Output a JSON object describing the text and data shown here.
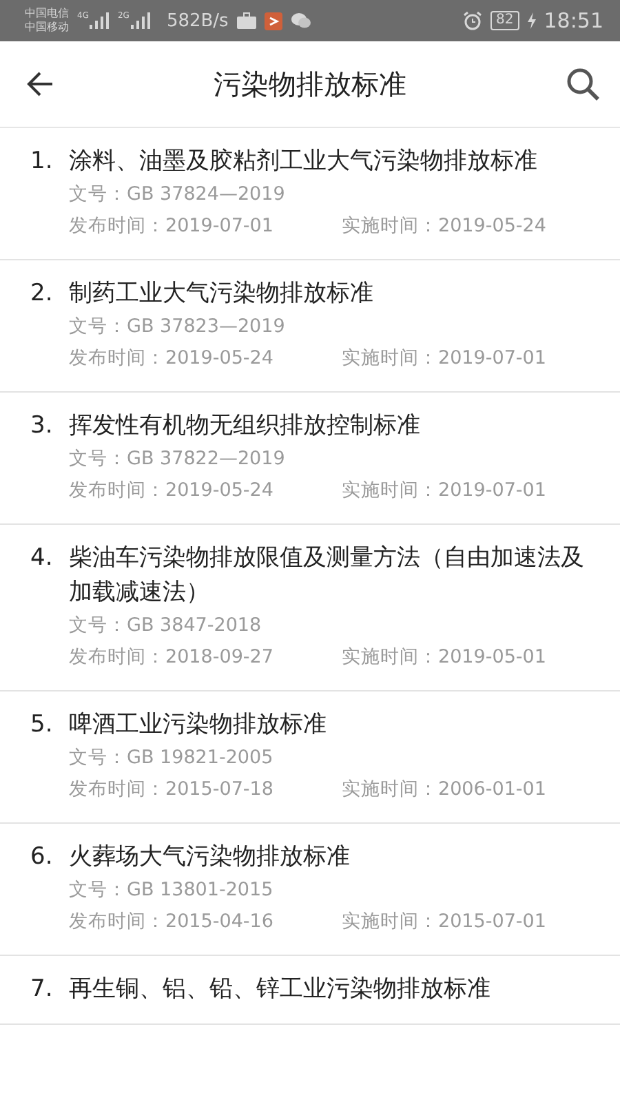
{
  "status_bar": {
    "carriers": [
      "中国电信",
      "中国移动"
    ],
    "signals": [
      "4G",
      "2G"
    ],
    "speed": "582B/s",
    "battery": "82",
    "time": "18:51"
  },
  "header": {
    "title": "污染物排放标准"
  },
  "standards": [
    {
      "index": "1.",
      "title": "涂料、油墨及胶粘剂工业大气污染物排放标准",
      "doc_no": "文号：GB 37824—2019",
      "published": "发布时间：2019-07-01",
      "effective": "实施时间：2019-05-24"
    },
    {
      "index": "2.",
      "title": "制药工业大气污染物排放标准",
      "doc_no": "文号：GB 37823—2019",
      "published": "发布时间：2019-05-24",
      "effective": "实施时间：2019-07-01"
    },
    {
      "index": "3.",
      "title": "挥发性有机物无组织排放控制标准",
      "doc_no": "文号：GB 37822—2019",
      "published": "发布时间：2019-05-24",
      "effective": "实施时间：2019-07-01"
    },
    {
      "index": "4.",
      "title": "柴油车污染物排放限值及测量方法（自由加速法及加载减速法）",
      "doc_no": "文号：GB 3847-2018",
      "published": "发布时间：2018-09-27",
      "effective": "实施时间：2019-05-01"
    },
    {
      "index": "5.",
      "title": "啤酒工业污染物排放标准",
      "doc_no": "文号：GB 19821-2005",
      "published": "发布时间：2015-07-18",
      "effective": "实施时间：2006-01-01"
    },
    {
      "index": "6.",
      "title": "火葬场大气污染物排放标准",
      "doc_no": "文号：GB 13801-2015",
      "published": "发布时间：2015-04-16",
      "effective": "实施时间：2015-07-01"
    },
    {
      "index": "7.",
      "title": "再生铜、铝、铅、锌工业污染物排放标准"
    }
  ]
}
